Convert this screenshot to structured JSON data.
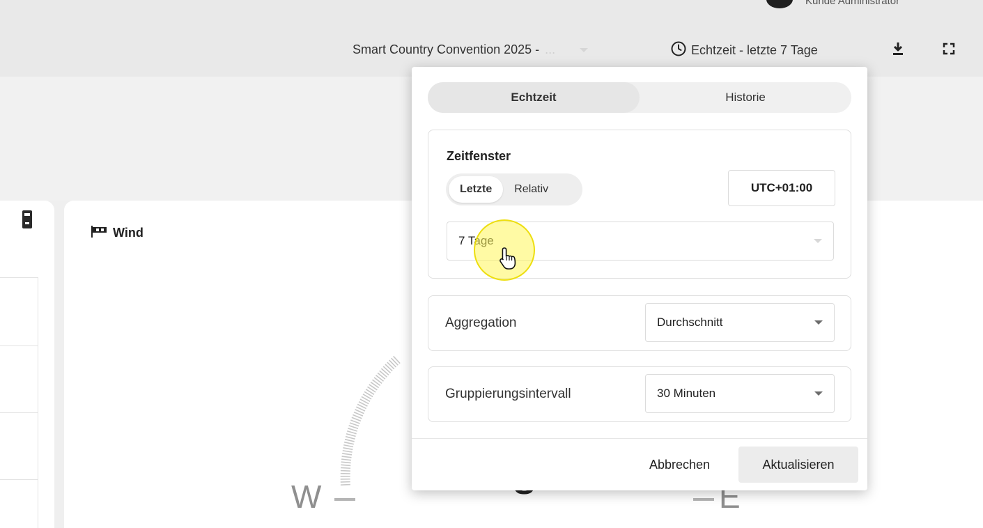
{
  "header": {
    "user_name": "Kunde Administrator",
    "dashboard_select": {
      "label": "Smart Country Convention 2025 -",
      "overflow": "..."
    },
    "time_button_label": "Echtzeit - letzte 7 Tage",
    "icons": [
      "clock-icon",
      "download-icon",
      "fullscreen-icon"
    ]
  },
  "wind_card": {
    "title": "Wind",
    "compass": {
      "west": "W",
      "east": "E",
      "center": "S"
    }
  },
  "popup": {
    "tabs": [
      {
        "label": "Echtzeit",
        "active": true
      },
      {
        "label": "Historie",
        "active": false
      }
    ],
    "zeitfenster": {
      "title": "Zeitfenster",
      "mode_tabs": [
        {
          "label": "Letzte",
          "active": true
        },
        {
          "label": "Relativ",
          "active": false
        }
      ],
      "timezone": "UTC+01:00",
      "selected_window": "7 Tage"
    },
    "aggregation": {
      "label": "Aggregation",
      "value": "Durchschnitt"
    },
    "grouping": {
      "label": "Gruppierungsintervall",
      "value": "30 Minuten"
    },
    "buttons": {
      "cancel": "Abbrechen",
      "submit": "Aktualisieren"
    }
  },
  "colors": {
    "page_background": "#efefef",
    "card_background": "#ffffff",
    "cursor_highlight": "#fff55a"
  }
}
